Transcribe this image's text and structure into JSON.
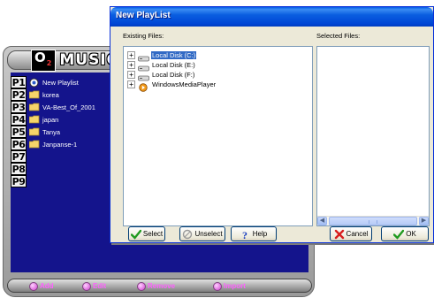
{
  "player": {
    "logo_o2": "O",
    "logo_o2_sub": "2",
    "logo_text": "MUSIC",
    "rows": [
      {
        "num": "P1",
        "icon": "new-playlist-icon",
        "label": "New Playlist"
      },
      {
        "num": "P2",
        "icon": "folder-icon",
        "label": "korea"
      },
      {
        "num": "P3",
        "icon": "folder-icon",
        "label": "VA-Best_Of_2001"
      },
      {
        "num": "P4",
        "icon": "folder-icon",
        "label": "japan"
      },
      {
        "num": "P5",
        "icon": "folder-icon",
        "label": "Tanya"
      },
      {
        "num": "P6",
        "icon": "folder-icon",
        "label": "Janpanse-1"
      },
      {
        "num": "P7",
        "icon": "",
        "label": ""
      },
      {
        "num": "P8",
        "icon": "",
        "label": ""
      },
      {
        "num": "P9",
        "icon": "",
        "label": ""
      }
    ],
    "bottom_buttons": [
      "Add",
      "Edit",
      "Remove",
      "Import"
    ]
  },
  "dialog": {
    "title": "New PlayList",
    "existing_label": "Existing Files:",
    "selected_label": "Selected Files:",
    "tree": [
      {
        "label": "Local Disk (C:)",
        "icon": "drive-icon",
        "selected": true
      },
      {
        "label": "Local Disk (E:)",
        "icon": "drive-icon",
        "selected": false
      },
      {
        "label": "Local Disk (F:)",
        "icon": "drive-icon",
        "selected": false
      },
      {
        "label": "WindowsMediaPlayer",
        "icon": "media-player-icon",
        "selected": false
      }
    ],
    "buttons": {
      "select": "Select",
      "unselect": "Unselect",
      "help": "Help",
      "cancel": "Cancel",
      "ok": "OK"
    }
  },
  "colors": {
    "playlist_bg": "#14148c",
    "title_blue": "#0046d5",
    "selection": "#316ac5",
    "dialog_face": "#ece9d8",
    "player_button_text": "#ff60ff"
  }
}
